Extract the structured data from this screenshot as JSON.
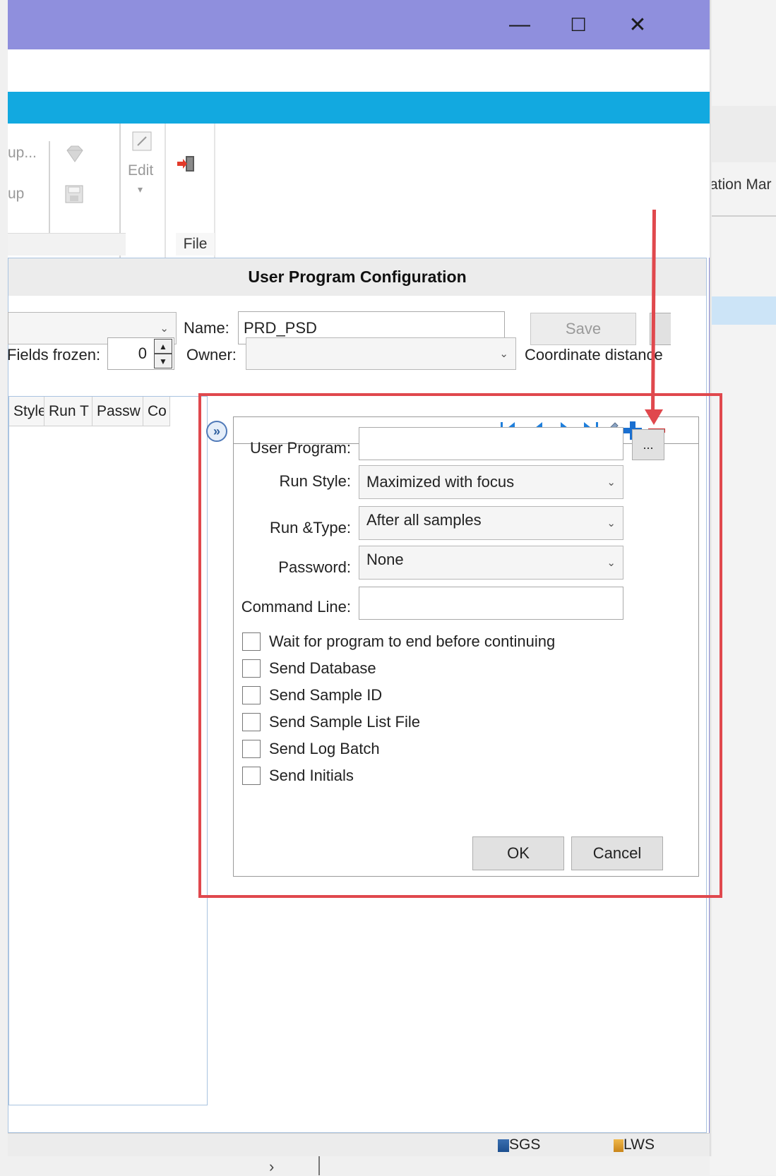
{
  "window": {
    "minimize_glyph": "—",
    "maximize_glyph": "☐",
    "close_glyph": "✕"
  },
  "ribbon": {
    "item1_label": "up...",
    "item2_label": "up",
    "edit_label": "Edit",
    "file_group_label": "File",
    "icons": [
      "gem-icon",
      "save-icon",
      "edit-icon",
      "exit-icon"
    ]
  },
  "background_app": {
    "label": "ation Mar"
  },
  "panel": {
    "title": "User Program Configuration",
    "name_label": "Name:",
    "name_value": "PRD_PSD",
    "save_label": "Save",
    "fields_frozen_label": "Fields frozen:",
    "fields_frozen_value": "0",
    "owner_label": "Owner:",
    "owner_value": "",
    "coordinate_label": "Coordinate distance"
  },
  "list": {
    "columns": [
      "Style",
      "Run T",
      "Passw",
      "Co"
    ]
  },
  "editor": {
    "expand_glyph": "»",
    "user_program_label": "User Program:",
    "user_program_value": "",
    "browse_label": "...",
    "run_style_label": "Run Style:",
    "run_style_value": "Maximized with focus",
    "run_type_label": "Run &Type:",
    "run_type_value": "After all samples",
    "password_label": "Password:",
    "password_value": "None",
    "command_line_label": "Command Line:",
    "command_line_value": "",
    "checkboxes": [
      {
        "label": "Wait for program to end before continuing",
        "checked": false
      },
      {
        "label": "Send Database",
        "checked": false
      },
      {
        "label": "Send Sample ID",
        "checked": false
      },
      {
        "label": "Send Sample List File",
        "checked": false
      },
      {
        "label": "Send Log Batch",
        "checked": false
      },
      {
        "label": "Send Initials",
        "checked": false
      }
    ],
    "ok_label": "OK",
    "cancel_label": "Cancel"
  },
  "status": {
    "sgs_label": "SGS",
    "lws_label": "LWS"
  },
  "scroll": {
    "right_glyph": "›"
  },
  "colors": {
    "titlebar": "#8f8fdd",
    "accent": "#12a9e0",
    "annotation": "#e0484d",
    "nav_blue": "#1f7fdc"
  }
}
